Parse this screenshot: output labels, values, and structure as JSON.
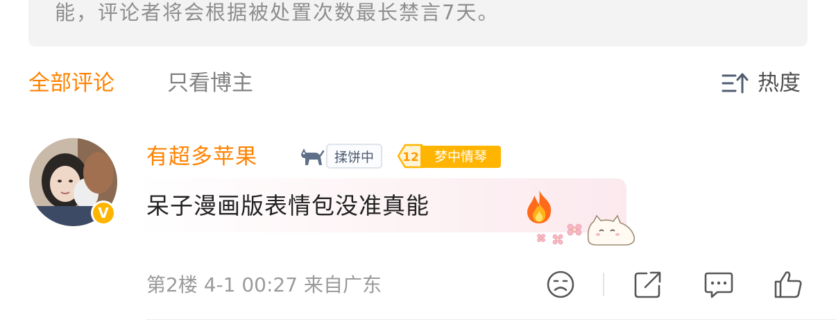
{
  "notice": {
    "text": "能，评论者将会根据被处置次数最长禁言7天。",
    "close_icon": "close-icon"
  },
  "tabs": {
    "all_comments": "全部评论",
    "blogger_only": "只看博主",
    "active_color": "#ff8200"
  },
  "sort": {
    "label": "热度",
    "icon": "sort-icon"
  },
  "comment": {
    "username": "有超多苹果",
    "username_color": "#ff8200",
    "status_badge": "揉饼中",
    "fan_badge": {
      "level": "12",
      "label": "梦中情琴"
    },
    "text": "呆子漫画版表情包没准真能",
    "emoji": "fire-emoji",
    "meta": {
      "floor": "第2楼",
      "time": "4-1 00:27",
      "location": "来自广东"
    },
    "actions": {
      "dislike_icon": "sad-face-icon",
      "share_icon": "share-icon",
      "reply_icon": "comment-icon",
      "like_icon": "thumbs-up-icon"
    }
  }
}
